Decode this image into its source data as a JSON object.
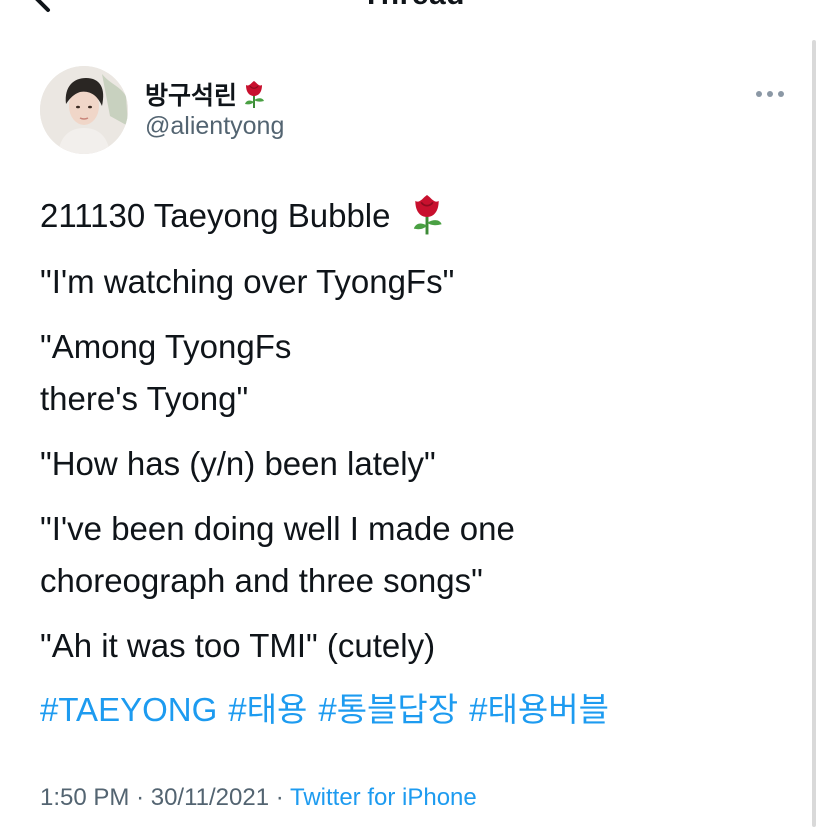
{
  "nav": {
    "title": "Thread"
  },
  "author": {
    "display_name": "방구석린",
    "handle": "@alientyong"
  },
  "tweet": {
    "line1": "211130 Taeyong Bubble",
    "line2": "\"I'm watching over TyongFs\"",
    "line3": "\"Among TyongFs",
    "line4": "there's Tyong\"",
    "line5": "\"How has (y/n) been lately\"",
    "line6": "\"I've been doing well I made one",
    "line7": "choreograph and three songs\"",
    "line8": "\"Ah it was too TMI\" (cutely)",
    "hashtags": [
      "#TAEYONG",
      "#태용",
      "#통블답장",
      "#태용버블"
    ]
  },
  "meta": {
    "time": "1:50 PM",
    "date": "30/11/2021",
    "separator": "·",
    "source": "Twitter for iPhone"
  },
  "colors": {
    "link": "#1d9bf0",
    "secondary_text": "#536471",
    "primary_text": "#0f1419",
    "rose": "#c8102e"
  },
  "icons": [
    "back-chevron-icon",
    "rose-emoji-icon",
    "more-options-icon"
  ]
}
